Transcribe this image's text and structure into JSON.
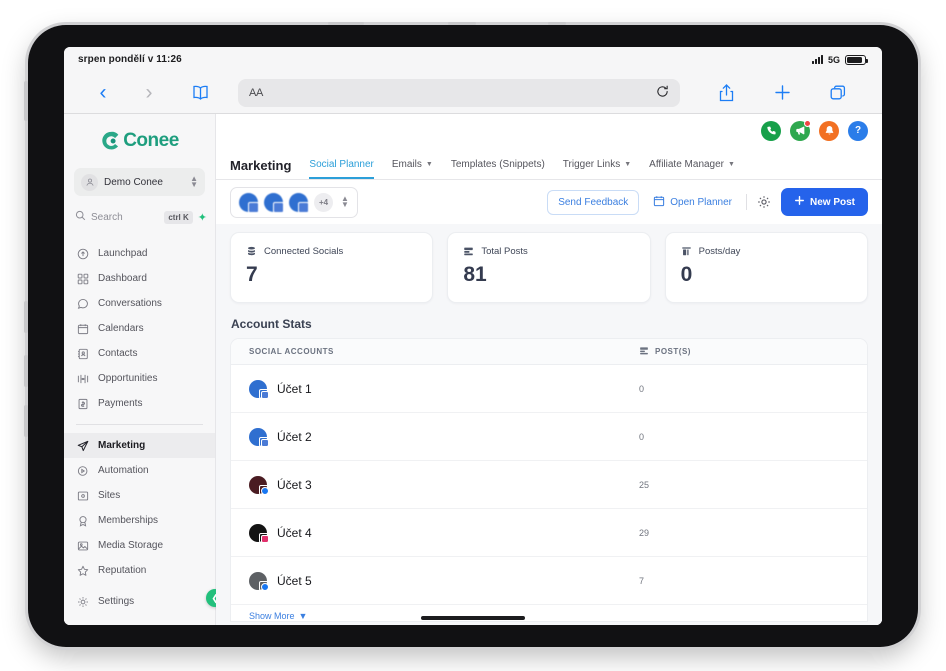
{
  "status_bar": {
    "time": "srpen pondělí v 11:26",
    "network": "5G",
    "signal_icon": "signal-bars-icon",
    "battery_icon": "battery-icon"
  },
  "browser": {
    "back_icon": "chevron-left-icon",
    "forward_icon": "chevron-right-icon",
    "bookmarks_icon": "book-icon",
    "aa_label": "AA",
    "reload_icon": "reload-icon",
    "share_icon": "share-icon",
    "new_tab_icon": "plus-icon",
    "tabs_icon": "tabs-icon"
  },
  "sidebar": {
    "logo": "Conee",
    "workspace": {
      "name": "Demo Conee",
      "avatar_icon": "user-circle-icon",
      "stepper_icon": "chevron-updown-icon"
    },
    "search": {
      "placeholder": "Search",
      "shortcut": "ctrl K",
      "search_icon": "search-icon",
      "spark_icon": "sparkle-icon"
    },
    "items_top": [
      {
        "label": "Launchpad",
        "icon": "rocket-icon",
        "active": false
      },
      {
        "label": "Dashboard",
        "icon": "grid-icon",
        "active": false
      },
      {
        "label": "Conversations",
        "icon": "chat-bubble-icon",
        "active": false
      },
      {
        "label": "Calendars",
        "icon": "calendar-icon",
        "active": false
      },
      {
        "label": "Contacts",
        "icon": "contacts-book-icon",
        "active": false
      },
      {
        "label": "Opportunities",
        "icon": "opportunities-icon",
        "active": false
      },
      {
        "label": "Payments",
        "icon": "payments-icon",
        "active": false
      }
    ],
    "items_bottom": [
      {
        "label": "Marketing",
        "icon": "paper-plane-icon",
        "active": true
      },
      {
        "label": "Automation",
        "icon": "play-circle-icon",
        "active": false
      },
      {
        "label": "Sites",
        "icon": "sites-icon",
        "active": false
      },
      {
        "label": "Memberships",
        "icon": "badge-icon",
        "active": false
      },
      {
        "label": "Media Storage",
        "icon": "image-icon",
        "active": false
      },
      {
        "label": "Reputation",
        "icon": "star-icon",
        "active": false
      }
    ],
    "settings": {
      "label": "Settings",
      "icon": "gear-icon"
    },
    "collapse_icon": "chevron-left-circle-icon",
    "collapse_color": "#22c07c"
  },
  "utility_icons": [
    {
      "name": "phone-icon",
      "glyph": "✆",
      "color": "#17a04a"
    },
    {
      "name": "announcement-icon",
      "glyph": "📣",
      "color": "#2fa84f",
      "badge": true
    },
    {
      "name": "notifications-bell-icon",
      "glyph": "🔔",
      "color": "#f27022"
    },
    {
      "name": "help-icon",
      "glyph": "?",
      "color": "#2b7de9"
    }
  ],
  "tabs": {
    "section_title": "Marketing",
    "items": [
      {
        "label": "Social Planner",
        "active": true,
        "caret": false
      },
      {
        "label": "Emails",
        "active": false,
        "caret": true
      },
      {
        "label": "Templates (Snippets)",
        "active": false,
        "caret": false
      },
      {
        "label": "Trigger Links",
        "active": false,
        "caret": true
      },
      {
        "label": "Affiliate Manager",
        "active": false,
        "caret": true
      }
    ],
    "active_color": "#2c9fd9"
  },
  "action_bar": {
    "avatar_more": "+4",
    "avatar_stepper_icon": "chevron-updown-icon",
    "send_feedback": "Send Feedback",
    "open_planner": "Open Planner",
    "open_planner_icon": "calendar-icon",
    "settings_icon": "gear-icon",
    "new_post": "New Post",
    "new_post_icon": "plus-icon",
    "new_post_color": "#2563eb"
  },
  "stats": [
    {
      "label": "Connected Socials",
      "value": "7",
      "icon": "database-icon"
    },
    {
      "label": "Total Posts",
      "value": "81",
      "icon": "stack-icon"
    },
    {
      "label": "Posts/day",
      "value": "0",
      "icon": "chart-bar-icon"
    }
  ],
  "account_stats": {
    "title": "Account Stats",
    "columns": [
      "SOCIAL ACCOUNTS",
      "POST(S)"
    ],
    "posts_col_icon": "stack-icon",
    "rows": [
      {
        "name": "Účet 1",
        "posts": "0",
        "avatar_color": "#2f6fd0",
        "badge_color": "#4b7bd6",
        "network_icon": "google-business-icon"
      },
      {
        "name": "Účet 2",
        "posts": "0",
        "avatar_color": "#2f6fd0",
        "badge_color": "#4b7bd6",
        "network_icon": "google-business-icon"
      },
      {
        "name": "Účet 3",
        "posts": "25",
        "avatar_color": "#4a1c22",
        "badge_color": "#1877f2",
        "network_icon": "facebook-icon"
      },
      {
        "name": "Účet 4",
        "posts": "29",
        "avatar_color": "#131313",
        "badge_color": "#e1306c",
        "network_icon": "instagram-icon"
      },
      {
        "name": "Účet 5",
        "posts": "7",
        "avatar_color": "#5d6064",
        "badge_color": "#1877f2",
        "network_icon": "facebook-icon"
      }
    ],
    "show_more": "Show More"
  }
}
